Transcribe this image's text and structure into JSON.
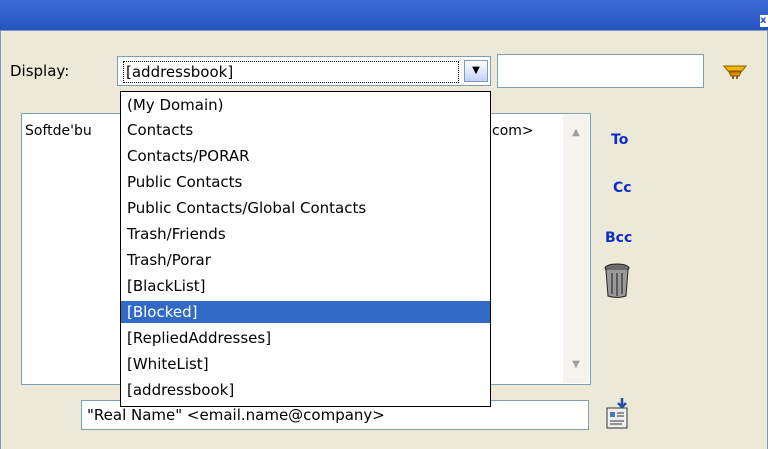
{
  "window": {
    "close_glyph": "x"
  },
  "display": {
    "label": "Display:",
    "selected_value": "[addressbook]"
  },
  "search": {
    "value": ""
  },
  "list": {
    "partial_row_text": "Softde'bu",
    "partial_row_tail": "com>"
  },
  "recipients": {
    "to_label": "To",
    "cc_label": "Cc",
    "bcc_label": "Bcc"
  },
  "address_input": {
    "value": "\"Real Name\" <email.name@company>"
  },
  "dropdown": {
    "selected_index": 9,
    "items": [
      "(My Domain)",
      "Contacts",
      "Contacts/PORAR",
      "Public Contacts",
      "Public Contacts/Global Contacts",
      "Trash/Friends",
      "Trash/Porar",
      "[BlackList]",
      "[Blocked]",
      "[RepliedAddresses]",
      "[WhiteList]",
      "[addressbook]"
    ]
  },
  "colors": {
    "selection": "#316ac5",
    "link": "#0b2fc8",
    "titlebar": "#2754c0"
  }
}
